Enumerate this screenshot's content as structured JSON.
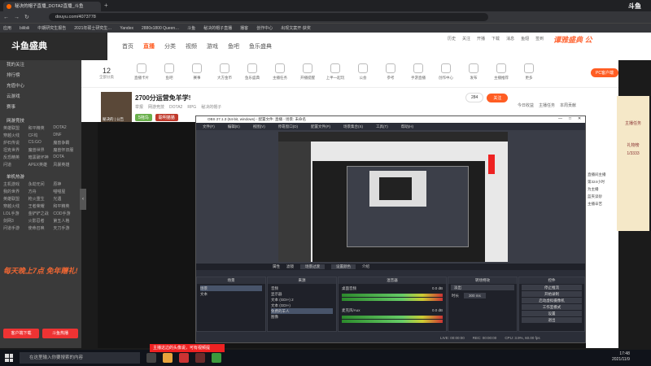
{
  "browser": {
    "tab_title": "秘决的帽子直播_DOTA2直播_斗鱼",
    "new_tab": "+",
    "url": "douyu.com/4073778",
    "bookmarks": [
      "应用",
      "bilibili",
      "中期研究生报告",
      "2021年硕士研究生…",
      "Yandex",
      "2880x1800 Queen…",
      "斗鱼",
      "秘决的帽子直播",
      "播客",
      "创作中心",
      "出现文案开·获奖"
    ]
  },
  "corner_logo": "斗鱼",
  "site": {
    "logo": "斗鱼盛典",
    "nav": [
      "首页",
      "直播",
      "分类",
      "视频",
      "游戏",
      "鱼吧",
      "鱼乐盛典"
    ],
    "nav_active_index": 1,
    "user_icons": [
      "历史",
      "关注",
      "开播",
      "下载",
      "消息",
      "鱼翅",
      "签到"
    ],
    "top_right_banner": "谭雅盛典 公"
  },
  "sidebar": {
    "items": [
      "我的关注",
      "排行榜",
      "充值中心",
      "云游戏",
      "赛事"
    ],
    "section_game": "网游竞技",
    "games": [
      "英雄联盟",
      "和平精英",
      "DOTA2",
      "穿越火线",
      "CF坞",
      "DNF",
      "炉石传说",
      "CS:GO",
      "魔兽争霸",
      "坦克世界",
      "魔兽世界",
      "魔兽怀旧服",
      "反恐精英",
      "暗黑破坏神",
      "DOTA",
      "问道",
      "APEX英雄",
      "风暴英雄"
    ],
    "section_mobile": "单机热游",
    "mobile_games": [
      "主机游戏",
      "永劫无间",
      "原神",
      "我的世界",
      "方舟",
      "喵喵屋",
      "英雄联盟",
      "枪火重生",
      "光遇",
      "穿越火线",
      "王者荣耀",
      "和平精英",
      "LOL手游",
      "金铲铲之战",
      "COD手游",
      "剑网3",
      "火影忍者",
      "第五人格",
      "问道手游",
      "使命召唤",
      "天刀手游"
    ],
    "promo": "每天晚上7点 免年赠礼!",
    "btn_left": "客户端下载",
    "btn_right": "斗鱼热播"
  },
  "categories": {
    "count": "12",
    "count_label": "全部分类",
    "items": [
      "直播卡片",
      "鱼吧",
      "赛事",
      "大方金币",
      "鱼乐盛典",
      "主播任务",
      "开播提醒",
      "上半一起玩",
      "公会",
      "参考",
      "手游直播",
      "创作中心",
      "发布",
      "主播推荐",
      "更多"
    ]
  },
  "room": {
    "title": "2700分运营免羊学!",
    "meta": [
      "举报",
      "网游竞技",
      "DOTA2",
      "RPG"
    ],
    "streamer": "秘决的帽子",
    "avatar_label": "秘决的 | 公告",
    "tags": [
      "5拖鸟",
      "聪明猫猫"
    ],
    "follow_count": "284",
    "follow_label": "关注",
    "rank_tabs": [
      "今日收益",
      "主播任务",
      "本周贡献"
    ],
    "pc_button": "PC客户端"
  },
  "obs": {
    "title": "OBS 27.1.3 (64-bit, windows) - 配置文件: 直播 - 场景: 未命名",
    "menu": [
      "文件(F)",
      "编辑(E)",
      "视图(V)",
      "停靠窗口(D)",
      "配置文件(P)",
      "场景集合(S)",
      "工具(T)",
      "帮助(H)"
    ],
    "source_bar": [
      "属性",
      "滤镜",
      "场景过渡",
      "设置颜色",
      "介绍"
    ],
    "panels": {
      "scenes": {
        "header": "场景",
        "items": [
          "场景",
          "文本"
        ]
      },
      "sources": {
        "header": "来源",
        "items": [
          "音频",
          "显示器",
          "文本 (GDI+) 2",
          "文本 (GDI+)",
          "免费的羊人",
          "图像"
        ]
      },
      "mixer": {
        "header": "混音器",
        "tracks": [
          {
            "name": "桌面音频",
            "db": "0.0 dB"
          },
          {
            "name": "麦克风/Aux",
            "db": "0.0 dB"
          }
        ]
      },
      "transitions": {
        "header": "转场特效",
        "type": "淡出",
        "duration_label": "时长",
        "duration": "300 ms"
      },
      "controls": {
        "header": "控件",
        "buttons": [
          "停止推流",
          "开始录制",
          "启动虚拟摄像机",
          "工作室模式",
          "设置",
          "退出"
        ]
      }
    },
    "status": [
      "LIVE: 00:00:00",
      "REC: 00:00:00",
      "CPU: 3.9%, 60.00 fps"
    ]
  },
  "chat_lines": [
    "直播间主播",
    "第324小时",
    "为主播",
    "蓝夹读砂",
    "主播辛苦"
  ],
  "right_ad": {
    "label": "主播任务",
    "sub": "礼物榜",
    "rank": "1/3333"
  },
  "taskbar": {
    "search_placeholder": "在这里输入你要搜索的内容",
    "notice": "主播这边的头像说，可有视频提",
    "time": "17:48",
    "date": "2021/11/9"
  },
  "colors": {
    "accent": "#ff5d23",
    "obs_bg": "#2b2e38",
    "live_red": "#e22222"
  }
}
